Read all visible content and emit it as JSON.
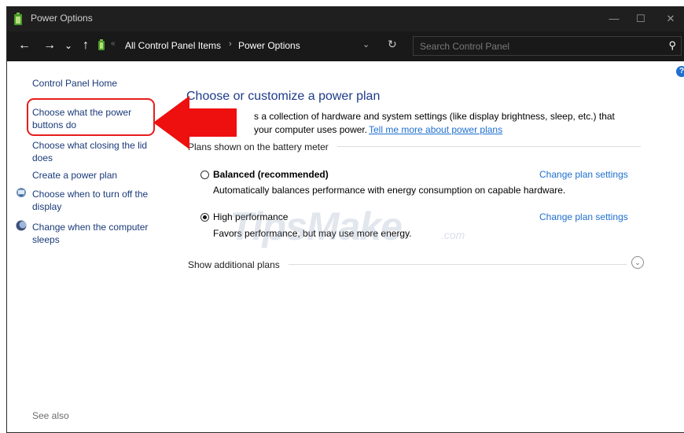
{
  "window": {
    "title": "Power Options",
    "controls": {
      "minimize": "—",
      "maximize": "☐",
      "close": "✕"
    }
  },
  "address_bar": {
    "back_icon": "←",
    "forward_icon": "→",
    "recent_icon": "⌄",
    "up_icon": "↑",
    "separator": "«",
    "crumbs": [
      "All Control Panel Items",
      "Power Options"
    ],
    "crumb_arrow": "›",
    "dropdown_icon": "⌄",
    "refresh_icon": "↻",
    "search_placeholder": "Search Control Panel",
    "search_icon": "⚲"
  },
  "sidebar": {
    "home": "Control Panel Home",
    "links": [
      "Choose what the power buttons do",
      "Choose what closing the lid does",
      "Create a power plan",
      "Choose when to turn off the display",
      "Change when the computer sleeps"
    ],
    "see_also": "See also"
  },
  "main": {
    "title": "Choose or customize a power plan",
    "description_visible": "s a collection of hardware and system settings (like display brightness, sleep, etc.) that",
    "description_line2": "your computer uses power.",
    "description_link": "Tell me more about power plans",
    "group_label": "Plans shown on the battery meter",
    "plans": [
      {
        "name": "Balanced (recommended)",
        "description": "Automatically balances performance with energy consumption on capable hardware.",
        "selected": false,
        "link": "Change plan settings"
      },
      {
        "name": "High performance",
        "description": "Favors performance, but may use more energy.",
        "selected": true,
        "link": "Change plan settings"
      }
    ],
    "more_plans": "Show additional plans",
    "expand_icon": "⌄"
  },
  "help_icon": "?",
  "watermark": {
    "text": "TipsMake",
    "suffix": ".com"
  },
  "colors": {
    "highlight": "#e81c1c",
    "link": "#1e6fd0",
    "title": "#1e3a8a",
    "titlebar": "#1f1f1f"
  }
}
